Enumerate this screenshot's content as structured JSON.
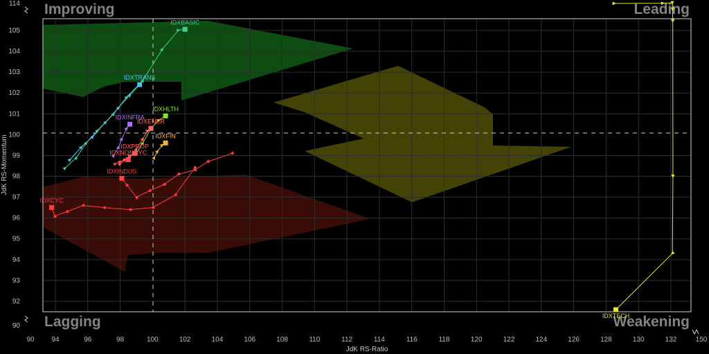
{
  "quadrants": {
    "improving": "Improving",
    "leading": "Leading",
    "lagging": "Lagging",
    "weakening": "Weakening"
  },
  "colors": {
    "background": "#000000",
    "grid": "#2e2e2e",
    "frame": "#cfcfcf",
    "crosshair": "#d0d0d0"
  },
  "chart_data": {
    "type": "scatter",
    "title": "",
    "xlabel": "JdK RS-Ratio",
    "ylabel": "JdK RS-Momentum",
    "xlim": [
      90,
      150
    ],
    "ylim": [
      90,
      114
    ],
    "center": {
      "x": 100,
      "y": 100
    },
    "grid": true,
    "x_ticks": [
      "90",
      "94",
      "96",
      "98",
      "100",
      "102",
      "104",
      "106",
      "108",
      "110",
      "112",
      "114",
      "116",
      "118",
      "120",
      "122",
      "124",
      "126",
      "128",
      "130",
      "132",
      "150"
    ],
    "y_ticks": [
      "114",
      "105",
      "104",
      "103",
      "102",
      "101",
      "100",
      "99",
      "98",
      "97",
      "96",
      "95",
      "94",
      "93",
      "92",
      "90"
    ],
    "series": [
      {
        "name": "IDXBASIC",
        "color": "#3ccf8e",
        "points": [
          [
            94.6,
            98.4
          ],
          [
            95.3,
            98.9
          ],
          [
            95.9,
            99.6
          ],
          [
            96.6,
            100.2
          ],
          [
            97.6,
            101.0
          ],
          [
            98.4,
            101.8
          ],
          [
            99.4,
            102.6
          ],
          [
            100.6,
            104.1
          ],
          [
            101.6,
            105.1
          ],
          [
            102.0,
            105.4
          ]
        ]
      },
      {
        "name": "IDXTRANS",
        "color": "#4fc3e8",
        "points": [
          [
            94.9,
            98.8
          ],
          [
            95.6,
            99.4
          ],
          [
            96.3,
            99.9
          ],
          [
            97.1,
            100.6
          ],
          [
            97.9,
            101.3
          ],
          [
            98.6,
            101.9
          ],
          [
            99.2,
            102.4
          ]
        ]
      },
      {
        "name": "IDXINFRA",
        "color": "#b06ef0",
        "points": [
          [
            97.6,
            99.0
          ],
          [
            97.9,
            99.4
          ],
          [
            98.1,
            99.8
          ],
          [
            98.4,
            100.3
          ],
          [
            98.6,
            100.5
          ]
        ]
      },
      {
        "name": "IDXHLTH",
        "color": "#8ee03a",
        "points": [
          [
            99.0,
            99.1
          ],
          [
            99.4,
            99.6
          ],
          [
            99.9,
            100.3
          ],
          [
            100.4,
            100.7
          ],
          [
            100.8,
            100.9
          ]
        ]
      },
      {
        "name": "IDXENER",
        "color": "#ff6e5a",
        "points": [
          [
            98.6,
            98.9
          ],
          [
            99.0,
            99.3
          ],
          [
            99.4,
            99.8
          ],
          [
            99.7,
            100.2
          ],
          [
            99.9,
            100.3
          ]
        ]
      },
      {
        "name": "IDXPROP",
        "color": "#ff5b5b",
        "points": [
          [
            98.0,
            98.6
          ],
          [
            98.3,
            98.8
          ],
          [
            98.6,
            99.0
          ],
          [
            98.9,
            99.1
          ]
        ]
      },
      {
        "name": "IDXNONCYC",
        "color": "#ff4d4d",
        "points": [
          [
            97.7,
            98.6
          ],
          [
            98.0,
            98.7
          ],
          [
            98.3,
            98.8
          ],
          [
            98.5,
            98.8
          ]
        ]
      },
      {
        "name": "IDXFIN",
        "color": "#f2b33a",
        "points": [
          [
            100.1,
            98.9
          ],
          [
            100.3,
            99.2
          ],
          [
            100.6,
            99.5
          ],
          [
            100.8,
            99.6
          ]
        ]
      },
      {
        "name": "IDXINDUS",
        "color": "#ff4040",
        "points": [
          [
            104.9,
            99.1
          ],
          [
            103.4,
            98.7
          ],
          [
            102.6,
            98.3
          ],
          [
            101.6,
            98.1
          ],
          [
            100.7,
            97.6
          ],
          [
            99.8,
            97.3
          ],
          [
            99.0,
            97.0
          ],
          [
            98.4,
            97.6
          ],
          [
            98.1,
            97.9
          ]
        ]
      },
      {
        "name": "IDXCYC",
        "color": "#ff3b3b",
        "points": [
          [
            102.6,
            98.4
          ],
          [
            101.4,
            97.1
          ],
          [
            100.0,
            96.5
          ],
          [
            98.6,
            96.4
          ],
          [
            97.0,
            96.5
          ],
          [
            95.7,
            96.6
          ],
          [
            94.7,
            96.3
          ],
          [
            93.9,
            96.1
          ],
          [
            93.4,
            96.5
          ]
        ]
      },
      {
        "name": "IDXTECH",
        "color": "#e8e23a",
        "points": [
          [
            128.5,
            114.0
          ],
          [
            131.5,
            114.1
          ],
          [
            132.8,
            114.2
          ],
          [
            133.0,
            112.1
          ],
          [
            133.1,
            108.2
          ],
          [
            133.2,
            98.0
          ],
          [
            132.9,
            94.3
          ],
          [
            128.6,
            91.6
          ]
        ]
      }
    ]
  }
}
